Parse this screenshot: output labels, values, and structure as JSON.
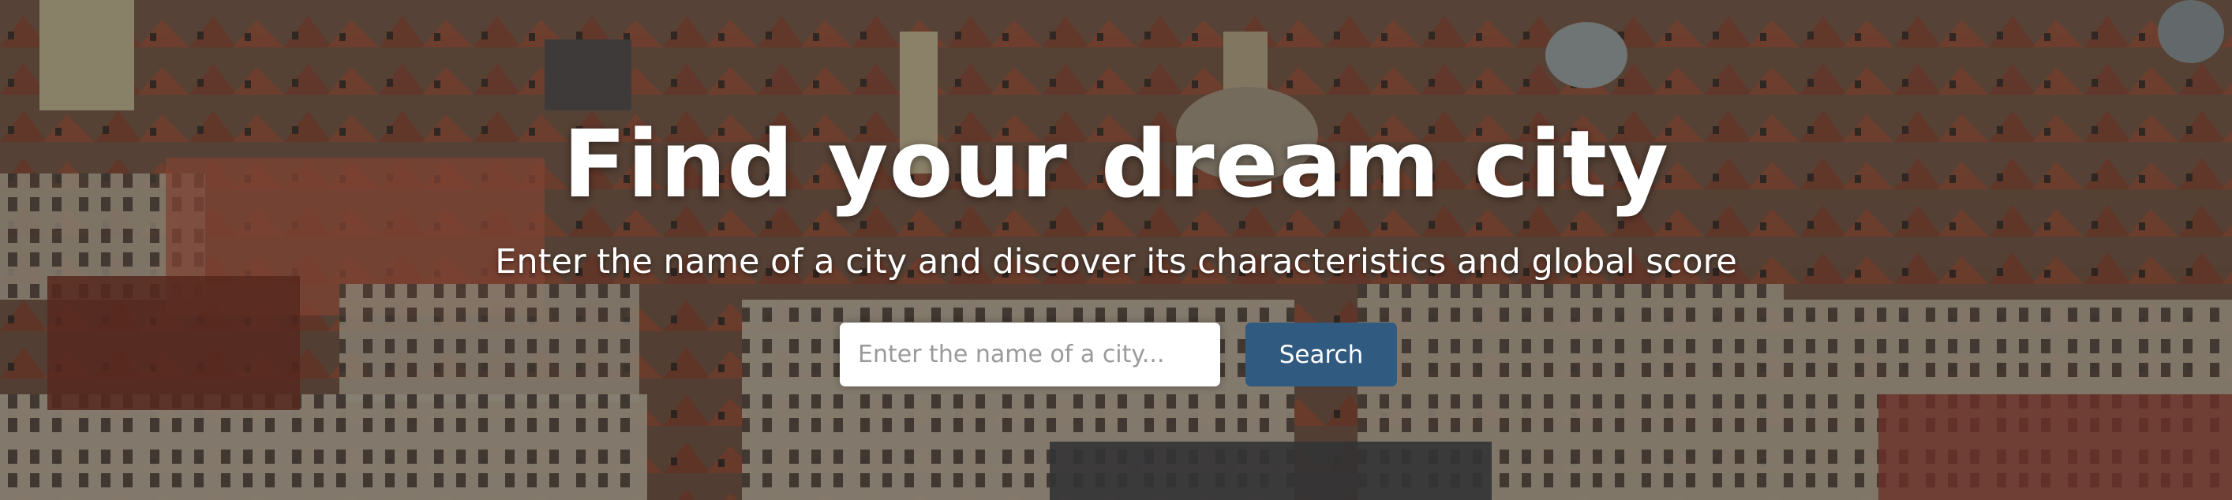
{
  "hero": {
    "title": "Find your dream city",
    "subtitle": "Enter the name of a city and discover its characteristics and global score",
    "background_image": "aerial-city-rooftops"
  },
  "search": {
    "placeholder": "Enter the name of a city...",
    "value": "",
    "button_label": "Search"
  },
  "colors": {
    "button_bg": "#305a80",
    "text": "#ffffff",
    "input_bg": "#ffffff",
    "placeholder": "#9a9a9a"
  }
}
